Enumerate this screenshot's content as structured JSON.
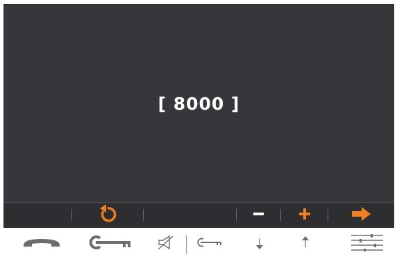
{
  "display": {
    "text": "[ 8000 ]"
  },
  "softkeys": [
    {
      "name": "back-icon"
    },
    {
      "name": "minus-icon"
    },
    {
      "name": "plus-icon"
    },
    {
      "name": "arrow-right-icon"
    }
  ],
  "hardware_buttons": [
    {
      "name": "hang-up-icon"
    },
    {
      "name": "door-key-icon"
    },
    {
      "name": "mute-speaker-icon"
    },
    {
      "name": "secondary-key-icon"
    },
    {
      "name": "arrow-down-icon"
    },
    {
      "name": "arrow-up-icon"
    },
    {
      "name": "menu-settings-icon"
    }
  ],
  "colors": {
    "screen_bg": "#37373b",
    "softkey_bg": "#2e2e31",
    "accent": "#f07f1f",
    "icon_gray": "#6d6d6d",
    "text": "#ffffff"
  }
}
